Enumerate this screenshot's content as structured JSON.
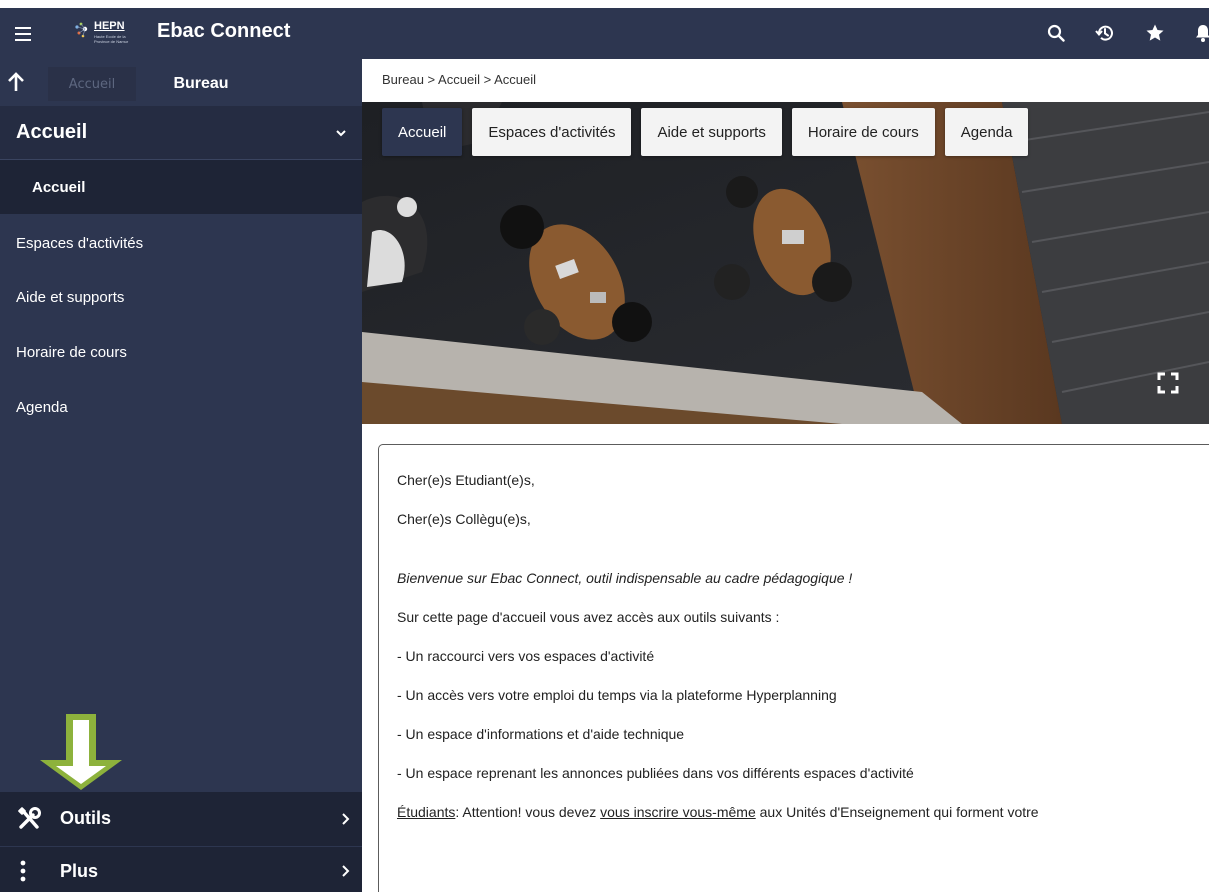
{
  "app": {
    "title": "Ebac Connect",
    "logo_text": "HEPN",
    "logo_subtext": "Haute Ecole de la Province de Namur"
  },
  "topbar": {
    "icons": [
      "search-icon",
      "history-icon",
      "star-icon",
      "bell-icon"
    ]
  },
  "sidebar": {
    "tabs": {
      "accueil": "Accueil",
      "bureau": "Bureau"
    },
    "section_title": "Accueil",
    "items": [
      {
        "label": "Accueil",
        "active": true
      },
      {
        "label": "Espaces d'activités",
        "active": false
      },
      {
        "label": "Aide et supports",
        "active": false
      },
      {
        "label": "Horaire de cours",
        "active": false
      },
      {
        "label": "Agenda",
        "active": false
      }
    ],
    "bottom": [
      {
        "label": "Outils",
        "icon": "tools-icon"
      },
      {
        "label": "Plus",
        "icon": "more-vertical-icon"
      }
    ]
  },
  "breadcrumb": [
    "Bureau",
    "Accueil",
    "Accueil"
  ],
  "hero_tabs": [
    "Accueil",
    "Espaces d'activités",
    "Aide et supports",
    "Horaire de cours",
    "Agenda"
  ],
  "content": {
    "greeting1": "Cher(e)s Etudiant(e)s,",
    "greeting2": "Cher(e)s Collègu(e)s,",
    "welcome": "Bienvenue sur Ebac Connect, outil indispensable au cadre pédagogique !",
    "intro": "Sur cette page d'accueil vous avez accès aux outils suivants :",
    "bullets": [
      "- Un raccourci vers vos espaces d'activité",
      "- Un accès vers votre emploi du temps via la plateforme Hyperplanning",
      "- Un espace d'informations et d'aide technique",
      "- Un espace reprenant les annonces publiées dans vos différents espaces d'activité"
    ],
    "note_label": "Étudiants",
    "note_pre": ": Attention! vous devez ",
    "note_link": "vous inscrire vous-même",
    "note_post": " aux Unités d'Enseignement qui forment votre"
  },
  "colors": {
    "navy": "#2d3650",
    "navy_dark": "#1e2436",
    "accent_green": "#8db23c"
  }
}
